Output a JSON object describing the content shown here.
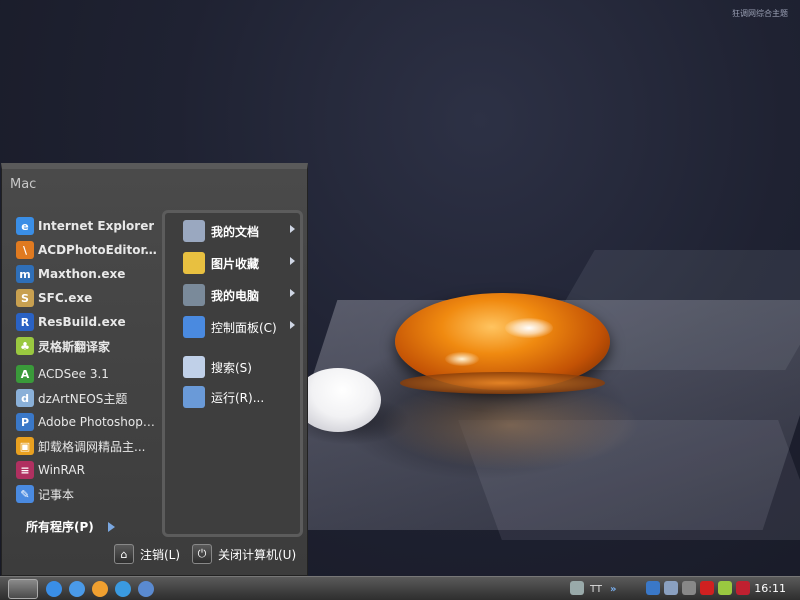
{
  "wallpaper": {
    "watermark": "狂调网综合主题"
  },
  "start_menu": {
    "title": "Mac",
    "programs": [
      {
        "label": "Internet Explorer",
        "icon": "internet-explorer-icon",
        "bold": true,
        "color": "#3a8ee6",
        "glyph": "e"
      },
      {
        "label": "ACDPhotoEditor...",
        "icon": "acd-photo-editor-icon",
        "bold": true,
        "color": "#e07a20",
        "glyph": "\\"
      },
      {
        "label": "Maxthon.exe",
        "icon": "maxthon-icon",
        "bold": true,
        "color": "#2f6fb8",
        "glyph": "m"
      },
      {
        "label": "SFC.exe",
        "icon": "sfc-icon",
        "bold": true,
        "color": "#c8a050",
        "glyph": "S"
      },
      {
        "label": "ResBuild.exe",
        "icon": "resbuild-icon",
        "bold": true,
        "color": "#2a62c4",
        "glyph": "R"
      },
      {
        "label": "灵格斯翻译家",
        "icon": "lingoes-icon",
        "bold": true,
        "color": "#9ac840",
        "glyph": "♣"
      },
      {
        "label": "ACDSee 3.1",
        "icon": "acdsee-icon",
        "bold": false,
        "color": "#3a9a3a",
        "glyph": "A"
      },
      {
        "label": "dzArtNEOS主题",
        "icon": "dzartneos-icon",
        "bold": false,
        "color": "#8ab0d8",
        "glyph": "d"
      },
      {
        "label": "Adobe Photoshop ...",
        "icon": "photoshop-icon",
        "bold": false,
        "color": "#3a78c8",
        "glyph": "P"
      },
      {
        "label": "卸载格调网精品主...",
        "icon": "uninstall-theme-icon",
        "bold": false,
        "color": "#e8a020",
        "glyph": "▣"
      },
      {
        "label": "WinRAR",
        "icon": "winrar-icon",
        "bold": false,
        "color": "#b03060",
        "glyph": "≡"
      },
      {
        "label": "记事本",
        "icon": "notepad-icon",
        "bold": false,
        "color": "#4a8ae0",
        "glyph": "✎"
      }
    ],
    "all_programs": "所有程序(P)",
    "places": [
      {
        "label": "我的文档",
        "icon": "my-documents-icon",
        "bold": true,
        "submenu": true,
        "color": "#9aa8c0"
      },
      {
        "label": "图片收藏",
        "icon": "my-pictures-icon",
        "bold": true,
        "submenu": true,
        "color": "#e8c040"
      },
      {
        "label": "我的电脑",
        "icon": "my-computer-icon",
        "bold": true,
        "submenu": true,
        "color": "#7a8a9a"
      },
      {
        "label": "控制面板(C)",
        "icon": "control-panel-icon",
        "bold": false,
        "submenu": true,
        "color": "#4a8ae0"
      },
      {
        "label": "搜索(S)",
        "icon": "search-icon",
        "bold": false,
        "submenu": false,
        "color": "#c0d0e8"
      },
      {
        "label": "运行(R)...",
        "icon": "run-icon",
        "bold": false,
        "submenu": false,
        "color": "#6a9ad8"
      }
    ],
    "logoff": "注销(L)",
    "shutdown": "关闭计算机(U)"
  },
  "taskbar": {
    "start_icon": "apple-icon",
    "quick_launch": [
      "show-desktop-icon",
      "ie-icon",
      "qq-pet-icon",
      "qq-icon",
      "explorer-icon"
    ],
    "tray_text": "TT",
    "tray_expand": "»",
    "clock": "16:11"
  }
}
